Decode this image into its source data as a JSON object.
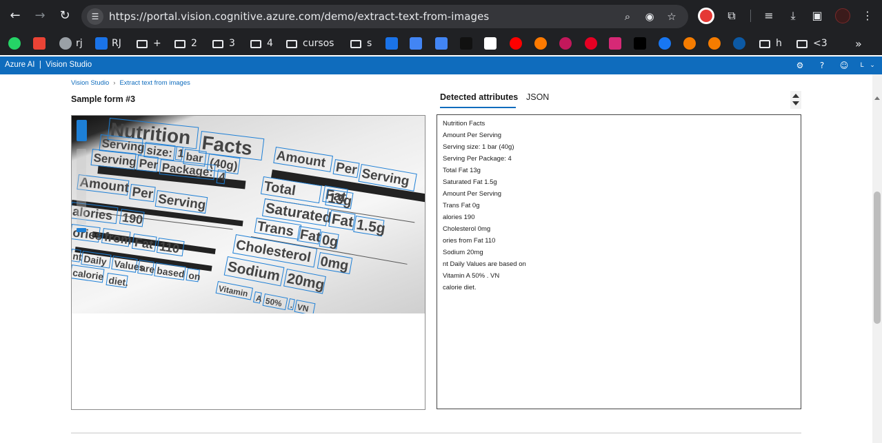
{
  "browser": {
    "url": "https://portal.vision.cognitive.azure.com/demo/extract-text-from-images",
    "bookmarks": [
      {
        "label": "",
        "icon": "whatsapp-icon",
        "color": "#25d366"
      },
      {
        "label": "",
        "icon": "gmail-icon",
        "color": "#ea4335"
      },
      {
        "label": "rj",
        "icon": "globe-icon",
        "color": "#9aa0a6"
      },
      {
        "label": "RJ",
        "icon": "rj-app-icon",
        "color": "#1a73e8"
      },
      {
        "label": "+",
        "icon": "folder-icon"
      },
      {
        "label": "2",
        "icon": "folder-icon"
      },
      {
        "label": "3",
        "icon": "folder-icon"
      },
      {
        "label": "4",
        "icon": "folder-icon"
      },
      {
        "label": "cursos",
        "icon": "folder-icon"
      },
      {
        "label": "s",
        "icon": "folder-icon"
      },
      {
        "label": "",
        "icon": "calendar-icon",
        "color": "#1a73e8"
      },
      {
        "label": "",
        "icon": "translate-icon",
        "color": "#4285f4"
      },
      {
        "label": "",
        "icon": "assistant-icon",
        "color": "#4285f4"
      },
      {
        "label": "",
        "icon": "k-icon",
        "color": "#111111"
      },
      {
        "label": "",
        "icon": "amazon-icon",
        "color": "#ffffff"
      },
      {
        "label": "",
        "icon": "youtube-music-icon",
        "color": "#ff0000"
      },
      {
        "label": "",
        "icon": "orange-circle-icon",
        "color": "#ff7a00"
      },
      {
        "label": "",
        "icon": "red-swirl-icon",
        "color": "#c2185b"
      },
      {
        "label": "",
        "icon": "pinterest-icon",
        "color": "#e60023"
      },
      {
        "label": "",
        "icon": "instagram-icon",
        "color": "#d62976"
      },
      {
        "label": "",
        "icon": "x-icon",
        "color": "#000000"
      },
      {
        "label": "",
        "icon": "facebook-icon",
        "color": "#1877f2"
      },
      {
        "label": "",
        "icon": "orange-gear-icon",
        "color": "#f57c00"
      },
      {
        "label": "",
        "icon": "orange-gear-2-icon",
        "color": "#f57c00"
      },
      {
        "label": "",
        "icon": "edge-icon",
        "color": "#0c59a4"
      },
      {
        "label": "h",
        "icon": "folder-icon"
      },
      {
        "label": "<3",
        "icon": "folder-icon"
      }
    ],
    "more_bookmarks": "»"
  },
  "app": {
    "brand": "Azure AI  |  Vision Studio",
    "header_user": "L",
    "breadcrumb": [
      "Vision Studio",
      "Extract text from images"
    ],
    "breadcrumb_sep": "›",
    "title": "Sample form #3"
  },
  "tabs": {
    "detected": "Detected attributes",
    "json": "JSON"
  },
  "results": [
    "Nutrition Facts",
    "Amount Per Serving",
    "Serving size: 1 bar (40g)",
    "Serving Per Package: 4",
    "Total Fat 13g",
    "Saturated Fat 1.5g",
    "Amount Per Serving",
    "Trans Fat 0g",
    "alories 190",
    "Cholesterol 0mg",
    "ories from Fat 110",
    "Sodium 20mg",
    "nt Daily Values are based on",
    "Vitamin A 50% . VN",
    "calorie diet."
  ],
  "photo_words": [
    "Nutrition",
    "Facts",
    "Serving",
    "size:",
    "1",
    "bar",
    "(40g)",
    "Serving",
    "Per",
    "Package:",
    "4",
    "Amount",
    "Per",
    "Serving",
    "Amount",
    "Per",
    "Serving",
    "Total",
    "Fat",
    "13g",
    "alories",
    "190",
    "Saturated",
    "Fat",
    "1.5g",
    "ories",
    "from",
    "Fat",
    "110",
    "Trans",
    "Fat",
    "0g",
    "Cholesterol",
    "0mg",
    "nt",
    "Daily",
    "Values",
    "are",
    "based",
    "on",
    "Sodium",
    "20mg",
    "calorie",
    "diet.",
    "Vitamin",
    "A",
    "50%",
    ".",
    "VN"
  ],
  "colors": {
    "chrome": "#202124",
    "accent": "#0f6cbd",
    "bbox": "#1d7fd6"
  }
}
